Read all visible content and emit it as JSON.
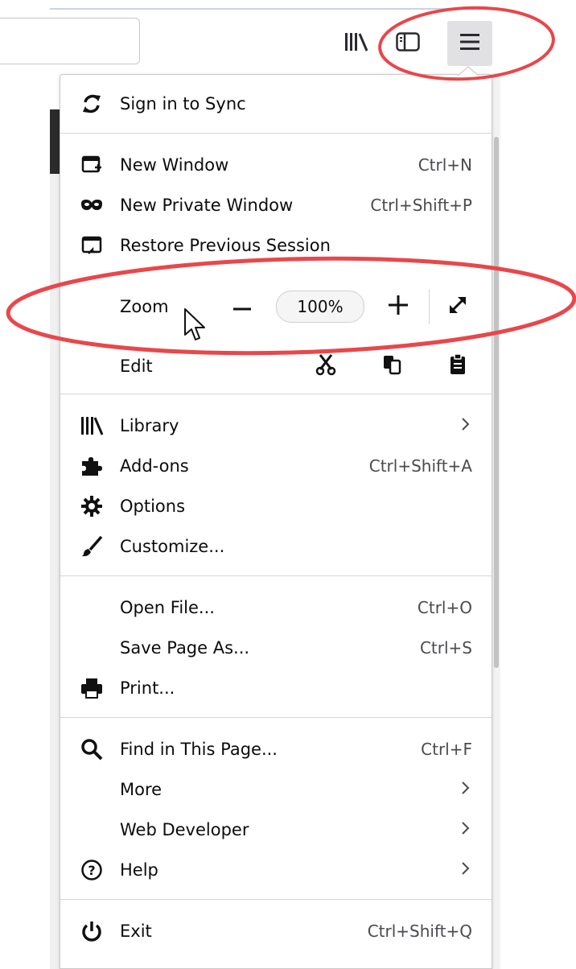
{
  "toolbar": {
    "library_icon": "library-icon",
    "sidebar_icon": "sidebar-icon",
    "menu_icon": "hamburger-menu-icon"
  },
  "menu": {
    "sync": {
      "label": "Sign in to Sync",
      "icon": "sync-icon"
    },
    "new_window": {
      "label": "New Window",
      "shortcut": "Ctrl+N",
      "icon": "new-window-icon"
    },
    "new_private": {
      "label": "New Private Window",
      "shortcut": "Ctrl+Shift+P",
      "icon": "private-mask-icon"
    },
    "restore": {
      "label": "Restore Previous Session",
      "icon": "restore-session-icon"
    },
    "zoom": {
      "label": "Zoom",
      "value": "100%"
    },
    "edit": {
      "label": "Edit"
    },
    "library": {
      "label": "Library",
      "icon": "library-icon"
    },
    "addons": {
      "label": "Add-ons",
      "shortcut": "Ctrl+Shift+A",
      "icon": "puzzle-icon"
    },
    "options": {
      "label": "Options",
      "icon": "gear-icon"
    },
    "customize": {
      "label": "Customize...",
      "icon": "brush-icon"
    },
    "open_file": {
      "label": "Open File...",
      "shortcut": "Ctrl+O"
    },
    "save_page": {
      "label": "Save Page As...",
      "shortcut": "Ctrl+S"
    },
    "print": {
      "label": "Print...",
      "icon": "printer-icon"
    },
    "find": {
      "label": "Find in This Page...",
      "shortcut": "Ctrl+F",
      "icon": "search-icon"
    },
    "more": {
      "label": "More"
    },
    "web_dev": {
      "label": "Web Developer"
    },
    "help": {
      "label": "Help",
      "icon": "help-icon"
    },
    "exit": {
      "label": "Exit",
      "shortcut": "Ctrl+Shift+Q",
      "icon": "power-icon"
    }
  },
  "colors": {
    "annotation": "#e8474b",
    "menu_button_bg": "#e1e1e3",
    "separator": "#d7d7db"
  }
}
